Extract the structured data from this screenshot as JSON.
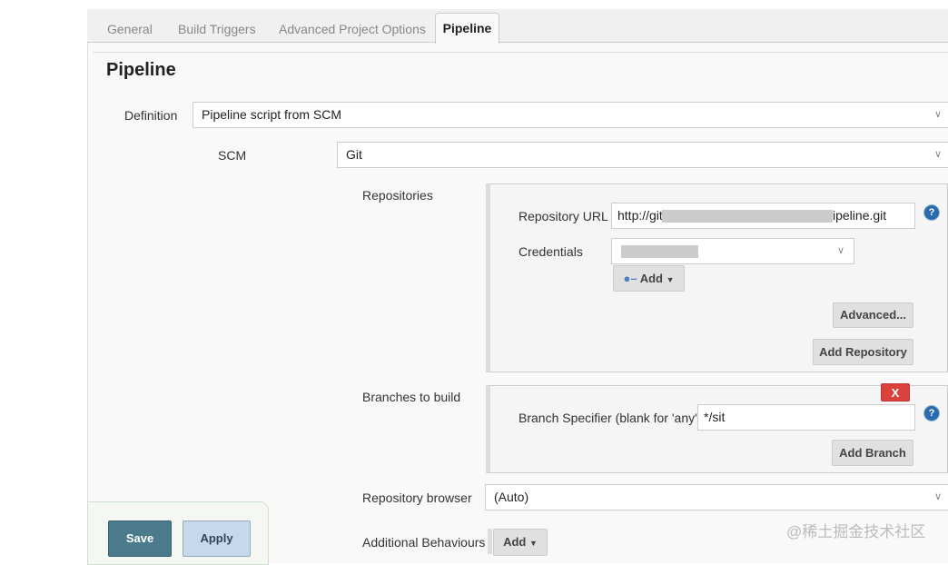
{
  "tabs": [
    "General",
    "Build Triggers",
    "Advanced Project Options",
    "Pipeline"
  ],
  "section_title": "Pipeline",
  "definition": {
    "label": "Definition",
    "value": "Pipeline script from SCM"
  },
  "scm": {
    "label": "SCM",
    "value": "Git"
  },
  "repositories": {
    "label": "Repositories",
    "url_label": "Repository URL",
    "url_prefix": "http://git",
    "url_suffix": "ipeline.git",
    "credentials_label": "Credentials",
    "add_label": "Add",
    "advanced_label": "Advanced...",
    "add_repository_label": "Add Repository"
  },
  "branches": {
    "label": "Branches to build",
    "delete_label": "X",
    "specifier_label": "Branch Specifier (blank for 'any')",
    "specifier_value": "*/sit",
    "add_branch_label": "Add Branch"
  },
  "repo_browser": {
    "label": "Repository browser",
    "value": "(Auto)"
  },
  "additional": {
    "label": "Additional Behaviours",
    "add_label": "Add"
  },
  "footer": {
    "save": "Save",
    "apply": "Apply"
  },
  "help_glyph": "?",
  "watermark": "@稀土掘金技术社区",
  "colors": {
    "save": "#4a7a8c",
    "apply": "#c6d9ec",
    "delete": "#d9413a",
    "help": "#2a6ab0"
  }
}
